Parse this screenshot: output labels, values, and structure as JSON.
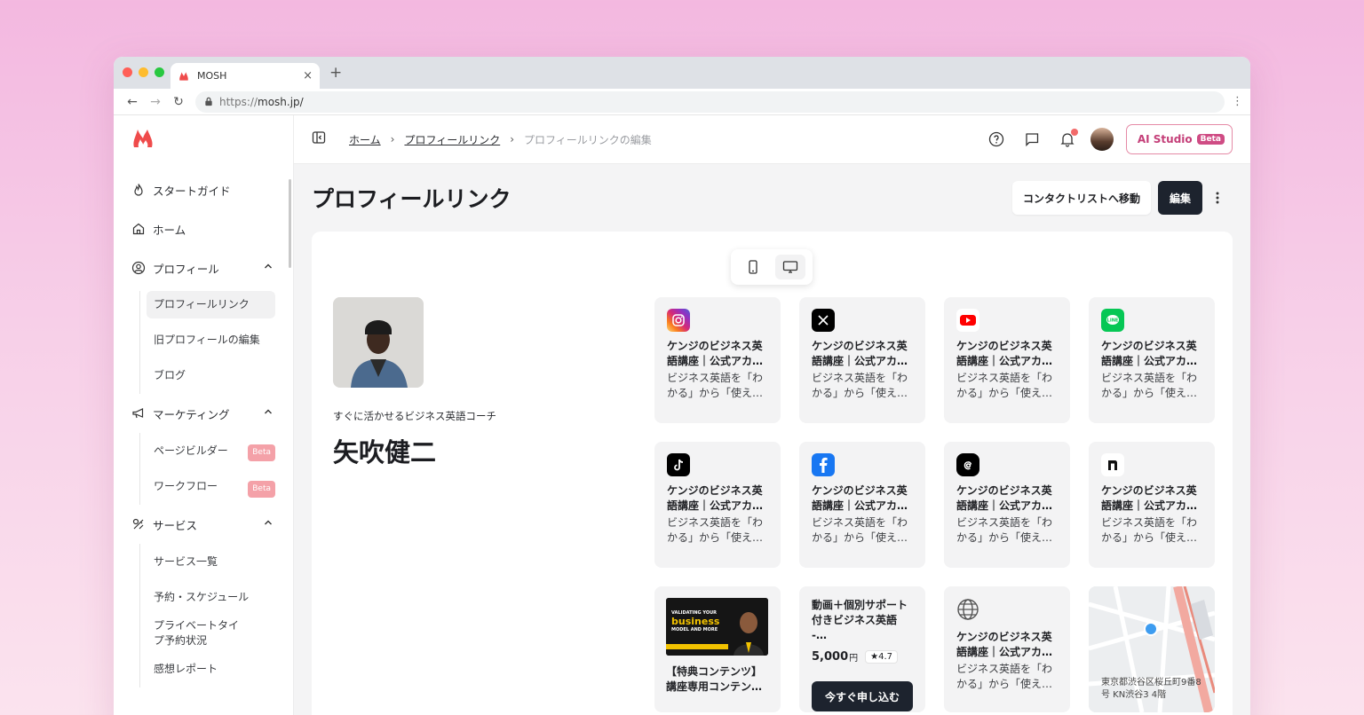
{
  "browser": {
    "tab_title": "MOSH",
    "new_tab": "+",
    "tab_close": "×",
    "url_protocol": "https://",
    "url_host": "mosh.jp/"
  },
  "sidebar": {
    "items": [
      {
        "label": "スタートガイド",
        "icon": "flame-icon"
      },
      {
        "label": "ホーム",
        "icon": "home-icon"
      },
      {
        "label": "プロフィール",
        "icon": "user-circle-icon",
        "children": [
          "プロフィールリンク",
          "旧プロフィールの編集",
          "ブログ"
        ]
      },
      {
        "label": "マーケティング",
        "icon": "megaphone-icon",
        "children": [
          "ページビルダー",
          "ワークフロー"
        ]
      },
      {
        "label": "サービス",
        "icon": "service-icon",
        "children": [
          "サービス一覧",
          "予約・スケジュール",
          "プライベートタイプ予約状況",
          "感想レポート"
        ]
      }
    ],
    "beta_badge": "Beta"
  },
  "topbar": {
    "breadcrumb": [
      "ホーム",
      "プロフィールリンク",
      "プロフィールリンクの編集"
    ],
    "separator": "›",
    "ai_studio": "AI Studio",
    "ai_beta": "Beta"
  },
  "page": {
    "title": "プロフィールリンク",
    "contact_button": "コンタクトリストへ移動",
    "edit_button": "編集"
  },
  "profile": {
    "tagline": "すぐに活かせるビジネス英語コーチ",
    "name": "矢吹健二"
  },
  "cards": {
    "title": "ケンジのビジネス英語講座｜公式アカ…",
    "title_line1": "ケンジのビジネス英",
    "title_line2": "語講座｜公式アカ…",
    "desc_line1": "ビジネス英語を「わ",
    "desc_line2": "かる」から「使え…",
    "sns": [
      "instagram-icon",
      "x-icon",
      "youtube-icon",
      "line-icon",
      "tiktok-icon",
      "facebook-icon",
      "threads-icon",
      "note-icon"
    ],
    "promo": {
      "thumb_l1": "VALIDATING YOUR",
      "thumb_l2": "business",
      "thumb_l3": "MODEL AND MORE",
      "title_line1": "【特典コンテンツ】",
      "title_line2": "講座専用コンテン…"
    },
    "service": {
      "title_line1": "動画＋個別サポート",
      "title_line2": "付きビジネス英語 -…",
      "price": "5,000",
      "currency": "円",
      "rating": "★4.7",
      "apply": "今すぐ申し込む"
    },
    "map": {
      "addr_line1": "東京都渋谷区桜丘町9番8",
      "addr_line2": "号 KN渋谷3 4階"
    }
  },
  "colors": {
    "accent_red": "#ef4b4b",
    "dark_button": "#1d232e",
    "ai_pink": "#cf4c84",
    "instagram": "#d6249f",
    "youtube": "#ff0000",
    "line": "#06c755",
    "facebook": "#1877f2"
  }
}
